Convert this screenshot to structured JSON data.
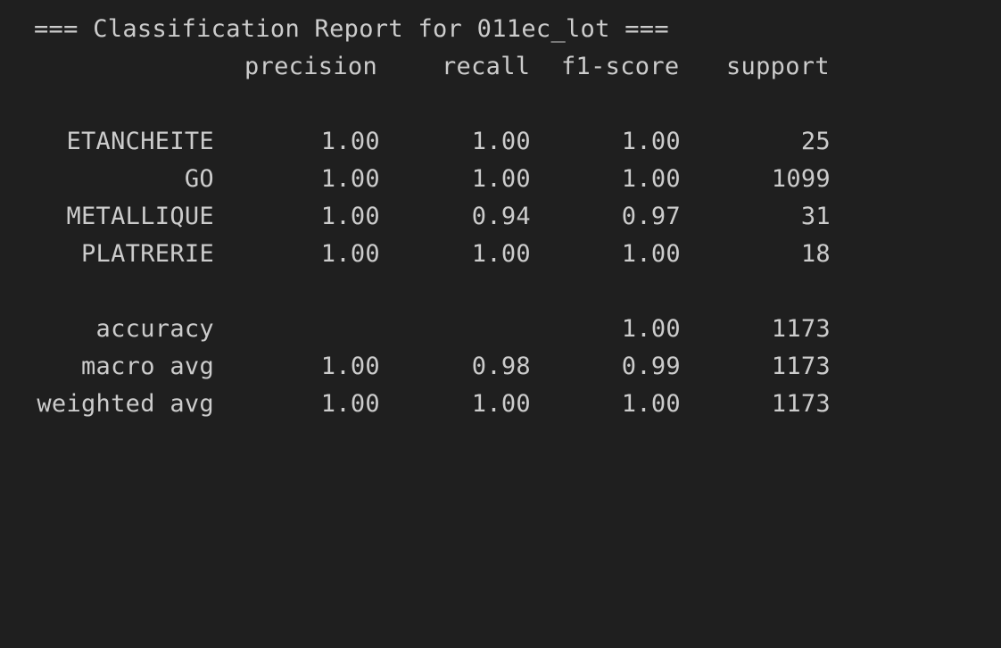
{
  "report": {
    "title": "=== Classification Report for 011ec_lot ===",
    "headers": {
      "precision": "precision",
      "recall": "recall",
      "f1": "f1-score",
      "support": "support"
    },
    "rows": [
      {
        "label": "ETANCHEITE",
        "precision": "1.00",
        "recall": "1.00",
        "f1": "1.00",
        "support": "25"
      },
      {
        "label": "GO",
        "precision": "1.00",
        "recall": "1.00",
        "f1": "1.00",
        "support": "1099"
      },
      {
        "label": "METALLIQUE",
        "precision": "1.00",
        "recall": "0.94",
        "f1": "0.97",
        "support": "31"
      },
      {
        "label": "PLATRERIE",
        "precision": "1.00",
        "recall": "1.00",
        "f1": "1.00",
        "support": "18"
      }
    ],
    "summary": [
      {
        "label": "accuracy",
        "precision": "",
        "recall": "",
        "f1": "1.00",
        "support": "1173"
      },
      {
        "label": "macro avg",
        "precision": "1.00",
        "recall": "0.98",
        "f1": "0.99",
        "support": "1173"
      },
      {
        "label": "weighted avg",
        "precision": "1.00",
        "recall": "1.00",
        "f1": "1.00",
        "support": "1173"
      }
    ]
  },
  "theme": {
    "background": "#1f1f1f",
    "text": "#cccccc"
  }
}
